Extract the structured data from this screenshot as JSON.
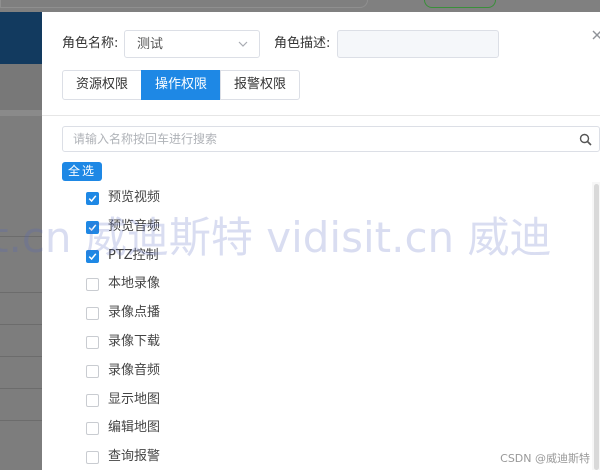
{
  "dialog": {
    "role_name_label": "角色名称:",
    "role_name_value": "测试",
    "role_desc_label": "角色描述:",
    "role_desc_value": ""
  },
  "tabs": [
    {
      "label": "资源权限",
      "active": false
    },
    {
      "label": "操作权限",
      "active": true
    },
    {
      "label": "报警权限",
      "active": false
    }
  ],
  "search": {
    "placeholder": "请输入名称按回车进行搜索"
  },
  "select_all_label": "全选",
  "permissions": [
    {
      "label": "预览视频",
      "checked": true
    },
    {
      "label": "预览音频",
      "checked": true
    },
    {
      "label": "PTZ控制",
      "checked": true
    },
    {
      "label": "本地录像",
      "checked": false
    },
    {
      "label": "录像点播",
      "checked": false
    },
    {
      "label": "录像下载",
      "checked": false
    },
    {
      "label": "录像音频",
      "checked": false
    },
    {
      "label": "显示地图",
      "checked": false
    },
    {
      "label": "编辑地图",
      "checked": false
    },
    {
      "label": "查询报警",
      "checked": false
    }
  ],
  "watermark_text": "t.cn 威迪斯特 vidisit.cn 威迪",
  "credit_text": "CSDN @威迪斯特",
  "colors": {
    "accent": "#1e88e5",
    "overlay": "#7d7d7d"
  },
  "icons": {
    "select_arrow": "chevron-down-icon",
    "close": "close-icon",
    "search": "search-icon",
    "checkmark": "checkmark-icon"
  }
}
